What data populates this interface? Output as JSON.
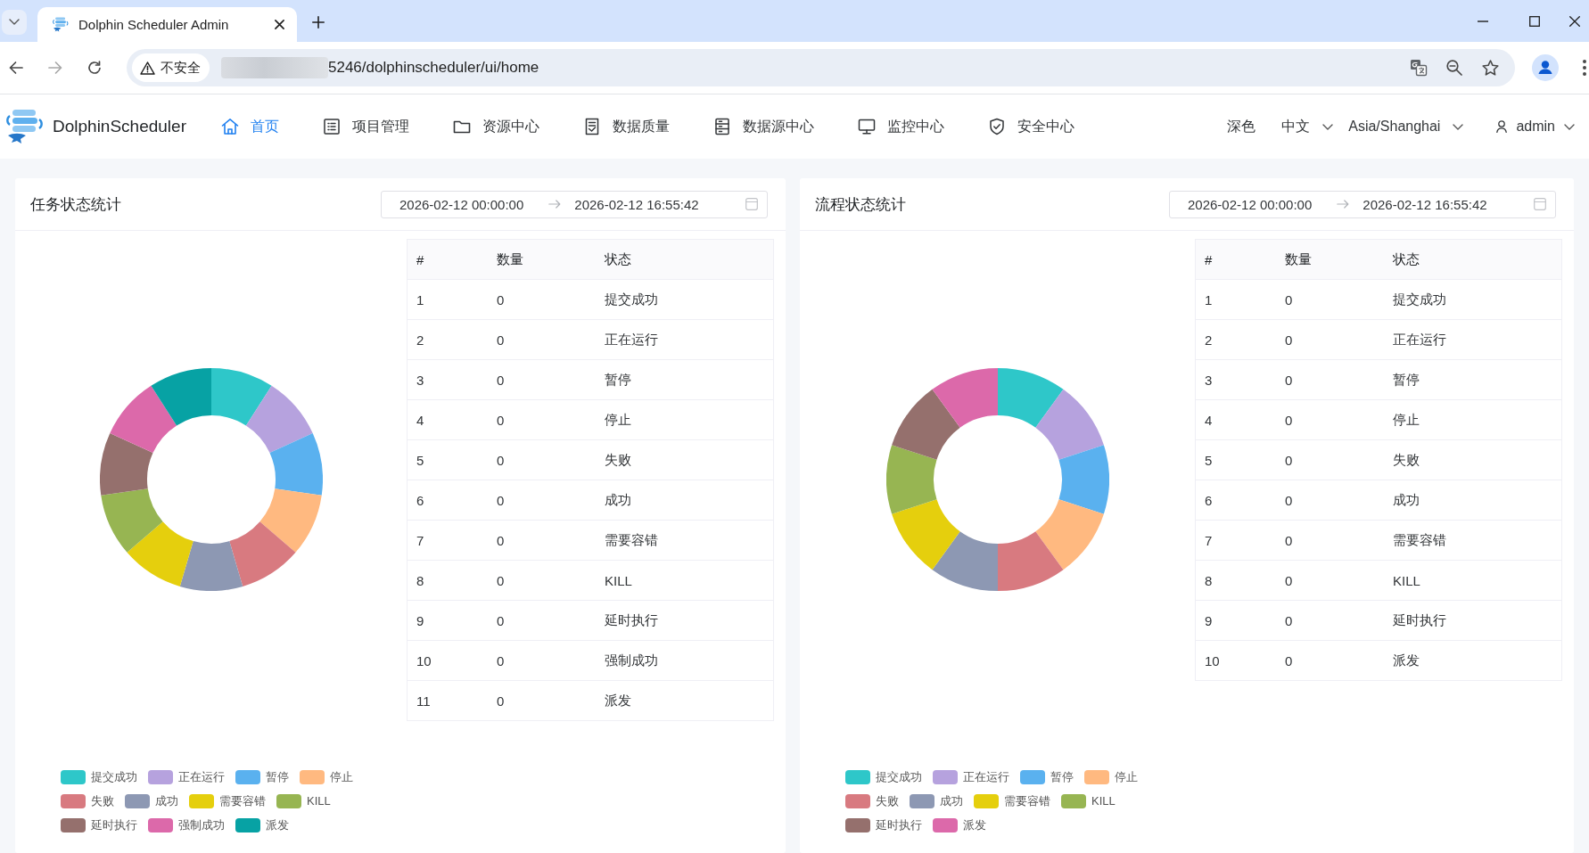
{
  "browser": {
    "tab_title": "Dolphin Scheduler Admin",
    "security_label": "不安全",
    "url": "5246/dolphinscheduler/ui/home"
  },
  "header": {
    "brand": "DolphinScheduler",
    "nav": [
      {
        "label": "首页",
        "selected": true
      },
      {
        "label": "项目管理",
        "selected": false
      },
      {
        "label": "资源中心",
        "selected": false
      },
      {
        "label": "数据质量",
        "selected": false
      },
      {
        "label": "数据源中心",
        "selected": false
      },
      {
        "label": "监控中心",
        "selected": false
      },
      {
        "label": "安全中心",
        "selected": false
      }
    ],
    "theme": "深色",
    "language": "中文",
    "timezone": "Asia/Shanghai",
    "user": "admin"
  },
  "panels": [
    {
      "title": "任务状态统计",
      "date_start": "2026-02-12 00:00:00",
      "date_end": "2026-02-12 16:55:42",
      "table": {
        "columns": [
          "#",
          "数量",
          "状态"
        ],
        "rows": [
          [
            "1",
            "0",
            "提交成功"
          ],
          [
            "2",
            "0",
            "正在运行"
          ],
          [
            "3",
            "0",
            "暂停"
          ],
          [
            "4",
            "0",
            "停止"
          ],
          [
            "5",
            "0",
            "失败"
          ],
          [
            "6",
            "0",
            "成功"
          ],
          [
            "7",
            "0",
            "需要容错"
          ],
          [
            "8",
            "0",
            "KILL"
          ],
          [
            "9",
            "0",
            "延时执行"
          ],
          [
            "10",
            "0",
            "强制成功"
          ],
          [
            "11",
            "0",
            "派发"
          ]
        ]
      },
      "legend": [
        {
          "label": "提交成功",
          "color": "#2ec7c9"
        },
        {
          "label": "正在运行",
          "color": "#b6a2de"
        },
        {
          "label": "暂停",
          "color": "#5ab1ef"
        },
        {
          "label": "停止",
          "color": "#ffb980"
        },
        {
          "label": "失败",
          "color": "#d87a80"
        },
        {
          "label": "成功",
          "color": "#8d98b3"
        },
        {
          "label": "需要容错",
          "color": "#e5cf0d"
        },
        {
          "label": "KILL",
          "color": "#97b552"
        },
        {
          "label": "延时执行",
          "color": "#95706d"
        },
        {
          "label": "强制成功",
          "color": "#dc69aa"
        },
        {
          "label": "派发",
          "color": "#07a2a4"
        }
      ]
    },
    {
      "title": "流程状态统计",
      "date_start": "2026-02-12 00:00:00",
      "date_end": "2026-02-12 16:55:42",
      "table": {
        "columns": [
          "#",
          "数量",
          "状态"
        ],
        "rows": [
          [
            "1",
            "0",
            "提交成功"
          ],
          [
            "2",
            "0",
            "正在运行"
          ],
          [
            "3",
            "0",
            "暂停"
          ],
          [
            "4",
            "0",
            "停止"
          ],
          [
            "5",
            "0",
            "失败"
          ],
          [
            "6",
            "0",
            "成功"
          ],
          [
            "7",
            "0",
            "需要容错"
          ],
          [
            "8",
            "0",
            "KILL"
          ],
          [
            "9",
            "0",
            "延时执行"
          ],
          [
            "10",
            "0",
            "派发"
          ]
        ]
      },
      "legend": [
        {
          "label": "提交成功",
          "color": "#2ec7c9"
        },
        {
          "label": "正在运行",
          "color": "#b6a2de"
        },
        {
          "label": "暂停",
          "color": "#5ab1ef"
        },
        {
          "label": "停止",
          "color": "#ffb980"
        },
        {
          "label": "失败",
          "color": "#d87a80"
        },
        {
          "label": "成功",
          "color": "#8d98b3"
        },
        {
          "label": "需要容错",
          "color": "#e5cf0d"
        },
        {
          "label": "KILL",
          "color": "#97b552"
        },
        {
          "label": "延时执行",
          "color": "#95706d"
        },
        {
          "label": "派发",
          "color": "#dc69aa"
        }
      ]
    }
  ]
}
